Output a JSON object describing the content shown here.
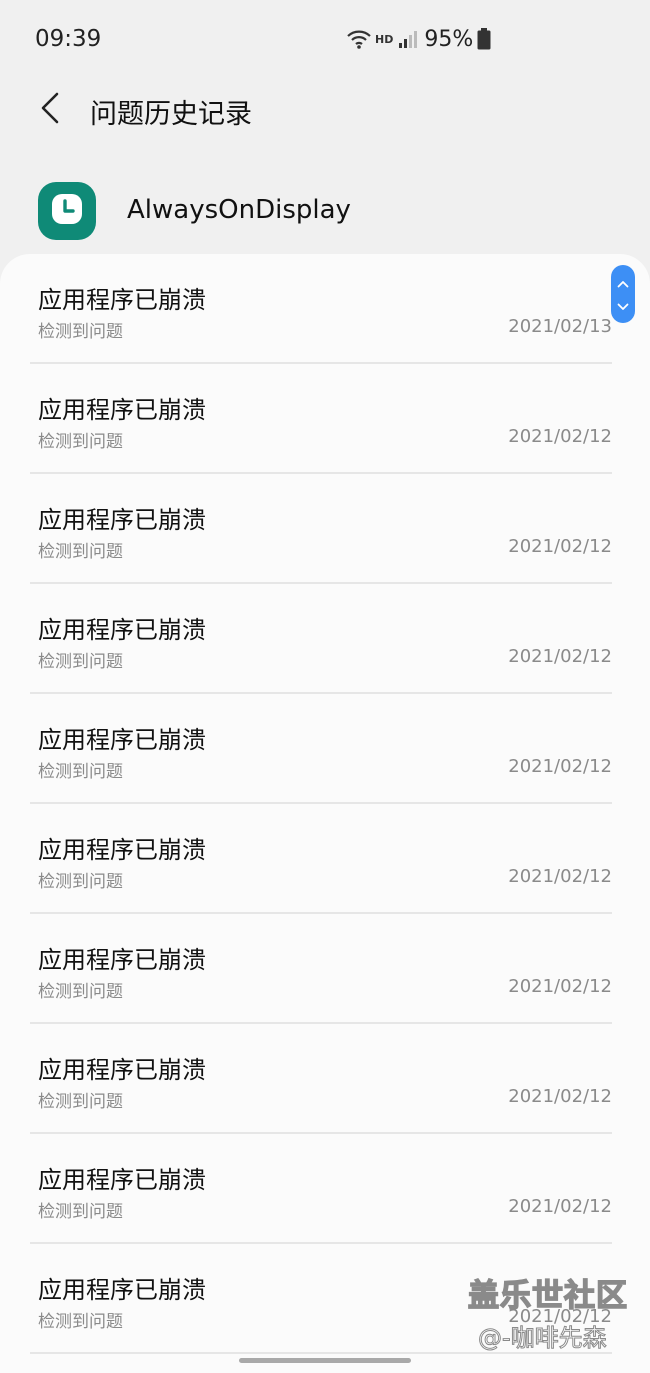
{
  "status_bar": {
    "time": "09:39",
    "network_label": "HD",
    "battery_percent": "95%",
    "icons": [
      "wifi-icon",
      "signal-icon",
      "battery-icon"
    ]
  },
  "header": {
    "back_icon": "chevron-left-icon",
    "title": "问题历史记录"
  },
  "app": {
    "icon": "clock-icon",
    "icon_color": "#0f8a77",
    "name": "AlwaysOnDisplay"
  },
  "history_items": [
    {
      "title": "应用程序已崩溃",
      "subtitle": "检测到问题",
      "date": "2021/02/13"
    },
    {
      "title": "应用程序已崩溃",
      "subtitle": "检测到问题",
      "date": "2021/02/12"
    },
    {
      "title": "应用程序已崩溃",
      "subtitle": "检测到问题",
      "date": "2021/02/12"
    },
    {
      "title": "应用程序已崩溃",
      "subtitle": "检测到问题",
      "date": "2021/02/12"
    },
    {
      "title": "应用程序已崩溃",
      "subtitle": "检测到问题",
      "date": "2021/02/12"
    },
    {
      "title": "应用程序已崩溃",
      "subtitle": "检测到问题",
      "date": "2021/02/12"
    },
    {
      "title": "应用程序已崩溃",
      "subtitle": "检测到问题",
      "date": "2021/02/12"
    },
    {
      "title": "应用程序已崩溃",
      "subtitle": "检测到问题",
      "date": "2021/02/12"
    },
    {
      "title": "应用程序已崩溃",
      "subtitle": "检测到问题",
      "date": "2021/02/12"
    },
    {
      "title": "应用程序已崩溃",
      "subtitle": "检测到问题",
      "date": "2021/02/12"
    }
  ],
  "scroll_handle": {
    "icons": [
      "chevron-up-icon",
      "chevron-down-icon"
    ],
    "color": "#3d8ff5"
  },
  "watermark": {
    "title": "盖乐世社区",
    "handle": "@-咖啡先森"
  }
}
